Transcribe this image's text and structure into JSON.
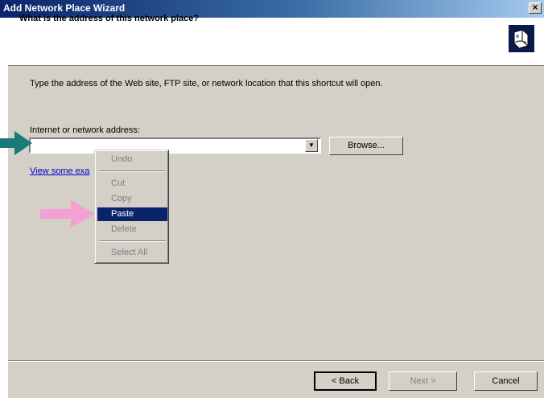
{
  "window": {
    "title": "Add Network Place Wizard",
    "close_glyph": "×"
  },
  "header": {
    "title": "What is the address of this network place?",
    "icon": "network-place-icon"
  },
  "main": {
    "instructions": "Type the address of the Web site, FTP site, or network location that this shortcut will open.",
    "address_label": "Internet or network address:",
    "address_value": "",
    "dropdown_glyph": "▼",
    "browse_label": "Browse...",
    "examples_link": "View some exa"
  },
  "context_menu": {
    "items": [
      {
        "label": "Undo",
        "enabled": false
      },
      {
        "label": "Cut",
        "enabled": false
      },
      {
        "label": "Copy",
        "enabled": false
      },
      {
        "label": "Paste",
        "enabled": true,
        "highlighted": true
      },
      {
        "label": "Delete",
        "enabled": false
      },
      {
        "label": "Select All",
        "enabled": false
      }
    ]
  },
  "annotations": {
    "teal_arrow_color": "#1a7a7a",
    "pink_arrow_color": "#f4a0d2",
    "highlight_color": "#0a246a"
  },
  "footer": {
    "back_label": "< Back",
    "next_label": "Next >",
    "cancel_label": "Cancel"
  }
}
